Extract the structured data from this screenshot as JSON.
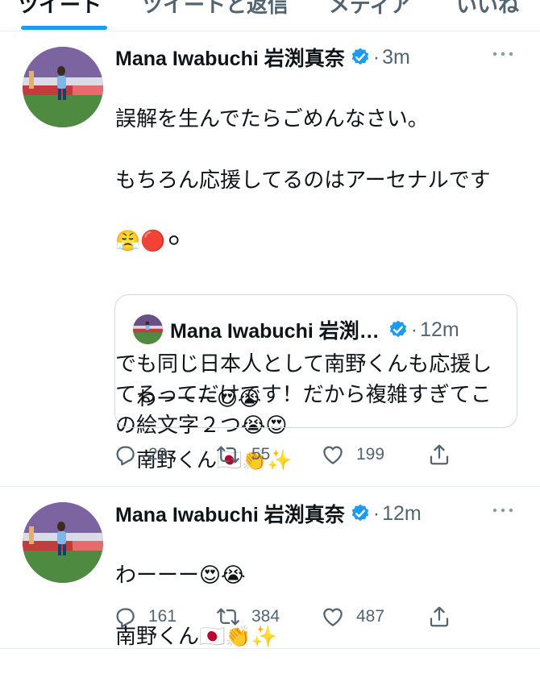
{
  "tabs": {
    "items": [
      "ツイート",
      "ツイートと返信",
      "メディア",
      "いいね"
    ]
  },
  "tweet1": {
    "author": "Mana Iwabuchi 岩渕真奈",
    "separator": "·",
    "time": "3m",
    "text_line1": "誤解を生んでたらごめんなさい。",
    "text_line2": "もちろん応援してるのはアーセナルです",
    "emojis_line3": "😤🔴⚪",
    "text_para2": "でも同じ日本人として南野くんも応援してるってだけです！だから複雑すぎてこの絵文字２つ😭😍",
    "quote": {
      "author": "Mana Iwabuchi 岩渕…",
      "separator": "·",
      "time": "12m",
      "text_line1": "わーーー😍😭",
      "text_line2": "南野くん🇯🇵👏✨"
    },
    "reply_count": "22",
    "retweet_count": "55",
    "like_count": "199"
  },
  "tweet2": {
    "author": "Mana Iwabuchi 岩渕真奈",
    "separator": "·",
    "time": "12m",
    "text_line1": "わーーー😍😭",
    "text_line2": "南野くん🇯🇵👏✨",
    "reply_count": "161",
    "retweet_count": "384",
    "like_count": "487"
  },
  "colors": {
    "accent": "#1d9bf0",
    "text": "#0f1419",
    "secondary": "#536471",
    "border": "#e6ecf0"
  },
  "icons": [
    "verified-badge-icon",
    "more-icon",
    "reply-icon",
    "retweet-icon",
    "like-icon",
    "share-icon"
  ]
}
